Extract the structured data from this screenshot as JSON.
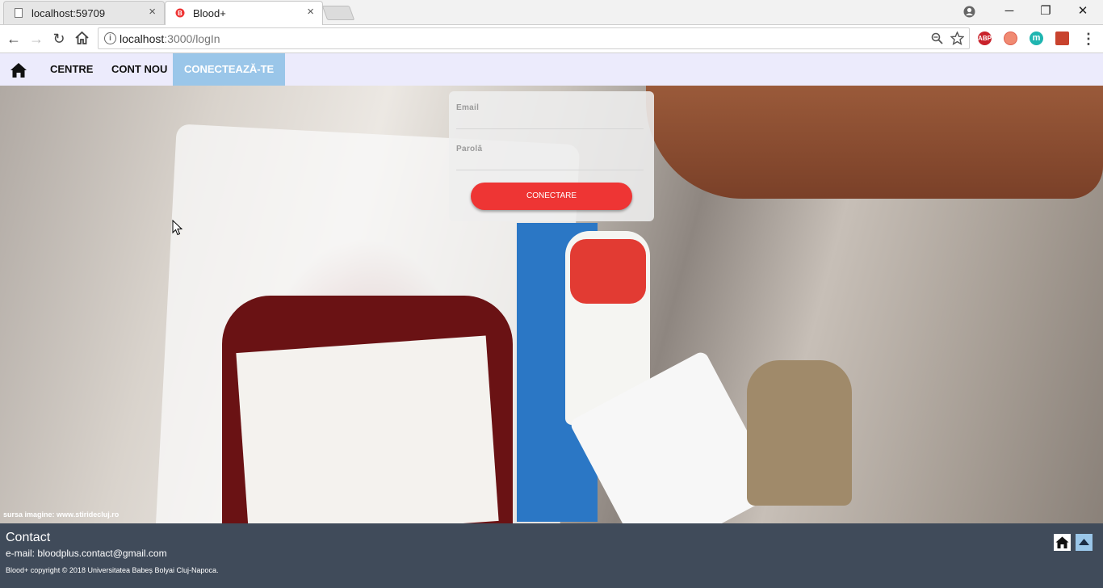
{
  "browser": {
    "tabs": [
      {
        "title": "localhost:59709",
        "close": "×"
      },
      {
        "title": "Blood+",
        "close": "×"
      }
    ],
    "window_controls": {
      "minimize": "─",
      "restore": "❐",
      "close": "✕"
    },
    "address": {
      "host": "localhost",
      "path": ":3000/logIn"
    },
    "extensions": [
      "ABP",
      "",
      "m",
      ""
    ]
  },
  "nav": {
    "items": [
      {
        "label": "CENTRE"
      },
      {
        "label": "CONT NOU"
      },
      {
        "label": "CONECTEAZĂ-TE"
      }
    ],
    "active_color": "#9ac6e9"
  },
  "login": {
    "email_label": "Email",
    "password_label": "Parolă",
    "button_label": "CONECTARE",
    "button_color": "#ee3534"
  },
  "hero": {
    "credit": "sursa imagine: www.stiridecluj.ro"
  },
  "footer": {
    "heading": "Contact",
    "email": "e-mail: bloodplus.contact@gmail.com",
    "copyright": "Blood+ copyright © 2018 Universitatea Babeș Bolyai Cluj-Napoca."
  }
}
